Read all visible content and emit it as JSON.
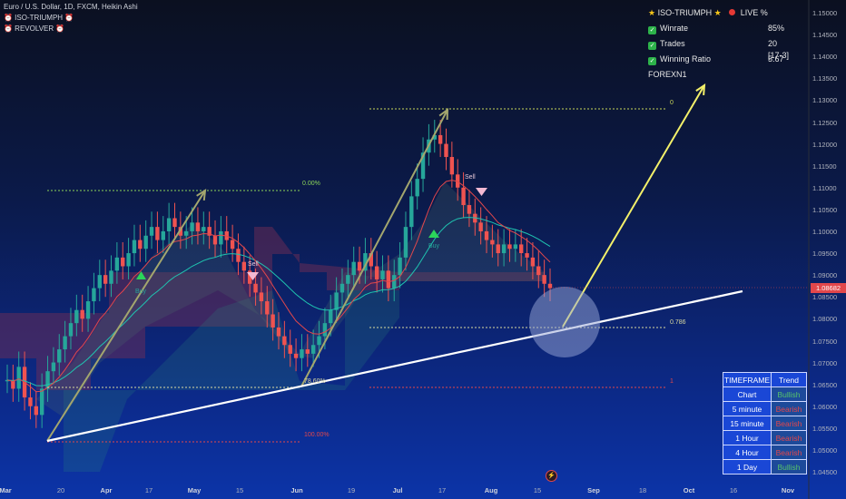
{
  "header": {
    "symbol_line": "Euro / U.S. Dollar, 1D, FXCM, Heikin Ashi",
    "indicator1": "⏰ ISO-TRIUMPH ⏰",
    "indicator2": "⏰ REVOLVER ⏰"
  },
  "stats": {
    "title": "ISO-TRIUMPH",
    "live": "LIVE %",
    "rows": [
      {
        "label": "Winrate",
        "value": "85%"
      },
      {
        "label": "Trades",
        "value": "20 [17-3]"
      },
      {
        "label": "Winning Ratio",
        "value": "5.67"
      }
    ],
    "brand": "FOREXN1"
  },
  "y_axis": [
    "1.15000",
    "1.14500",
    "1.14000",
    "1.13500",
    "1.13000",
    "1.12500",
    "1.12000",
    "1.11500",
    "1.11000",
    "1.10500",
    "1.10000",
    "1.09500",
    "1.09000",
    "1.08500",
    "1.08000",
    "1.07500",
    "1.07000",
    "1.06500",
    "1.06000",
    "1.05500",
    "1.05000",
    "1.04500"
  ],
  "x_axis": [
    {
      "label": "Mar",
      "bold": true
    },
    {
      "label": "20",
      "bold": false
    },
    {
      "label": "Apr",
      "bold": true
    },
    {
      "label": "17",
      "bold": false
    },
    {
      "label": "May",
      "bold": true
    },
    {
      "label": "15",
      "bold": false
    },
    {
      "label": "Jun",
      "bold": true
    },
    {
      "label": "19",
      "bold": false
    },
    {
      "label": "Jul",
      "bold": true
    },
    {
      "label": "17",
      "bold": false
    },
    {
      "label": "Aug",
      "bold": true
    },
    {
      "label": "15",
      "bold": false
    },
    {
      "label": "Sep",
      "bold": true
    },
    {
      "label": "18",
      "bold": false
    },
    {
      "label": "Oct",
      "bold": true
    },
    {
      "label": "16",
      "bold": false
    },
    {
      "label": "Nov",
      "bold": true
    }
  ],
  "price_tag": "1.08682",
  "levels": {
    "p0": "0.00%",
    "p100": "100.00%",
    "p786a": "78.60%",
    "l0": "0",
    "l786": "0.786",
    "l1": "1"
  },
  "signals": {
    "buy": "Buy",
    "sell": "Sell"
  },
  "timeframe_table": {
    "headers": [
      "TIMEFRAME",
      "Trend"
    ],
    "rows": [
      {
        "tf": "Chart",
        "trend": "Bullish"
      },
      {
        "tf": "5 minute",
        "trend": "Bearish"
      },
      {
        "tf": "15 minute",
        "trend": "Bearish"
      },
      {
        "tf": "1 Hour",
        "trend": "Bearish"
      },
      {
        "tf": "4 Hour",
        "trend": "Bearish"
      },
      {
        "tf": "1 Day",
        "trend": "Bullish"
      }
    ]
  },
  "colors": {
    "bull": "#26a69a",
    "bear": "#ef5350",
    "accent": "#1a47d6"
  },
  "chart_data": {
    "type": "candlestick",
    "title": "Euro / U.S. Dollar, 1D, FXCM, Heikin Ashi",
    "ylim": [
      1.045,
      1.15
    ],
    "closes": [
      1.066,
      1.064,
      1.069,
      1.062,
      1.06,
      1.058,
      1.064,
      1.068,
      1.07,
      1.073,
      1.076,
      1.079,
      1.082,
      1.08,
      1.084,
      1.087,
      1.09,
      1.088,
      1.091,
      1.094,
      1.092,
      1.095,
      1.098,
      1.096,
      1.099,
      1.101,
      1.098,
      1.1,
      1.103,
      1.101,
      1.099,
      1.1,
      1.102,
      1.1,
      1.101,
      1.099,
      1.097,
      1.1,
      1.098,
      1.096,
      1.093,
      1.091,
      1.088,
      1.086,
      1.084,
      1.081,
      1.078,
      1.076,
      1.074,
      1.072,
      1.071,
      1.073,
      1.072,
      1.074,
      1.076,
      1.079,
      1.082,
      1.086,
      1.088,
      1.09,
      1.093,
      1.091,
      1.095,
      1.092,
      1.089,
      1.091,
      1.087,
      1.09,
      1.094,
      1.101,
      1.108,
      1.112,
      1.118,
      1.121,
      1.122,
      1.12,
      1.117,
      1.113,
      1.11,
      1.106,
      1.104,
      1.102,
      1.1,
      1.098,
      1.097,
      1.095,
      1.097,
      1.096,
      1.097,
      1.095,
      1.094,
      1.092,
      1.09,
      1.088,
      1.087
    ],
    "trend_lines": "ascending support line from March low through June low to late August",
    "fib_levels": [
      "0",
      "0.786",
      "1",
      "0.00%",
      "78.60%",
      "100.00%"
    ]
  }
}
